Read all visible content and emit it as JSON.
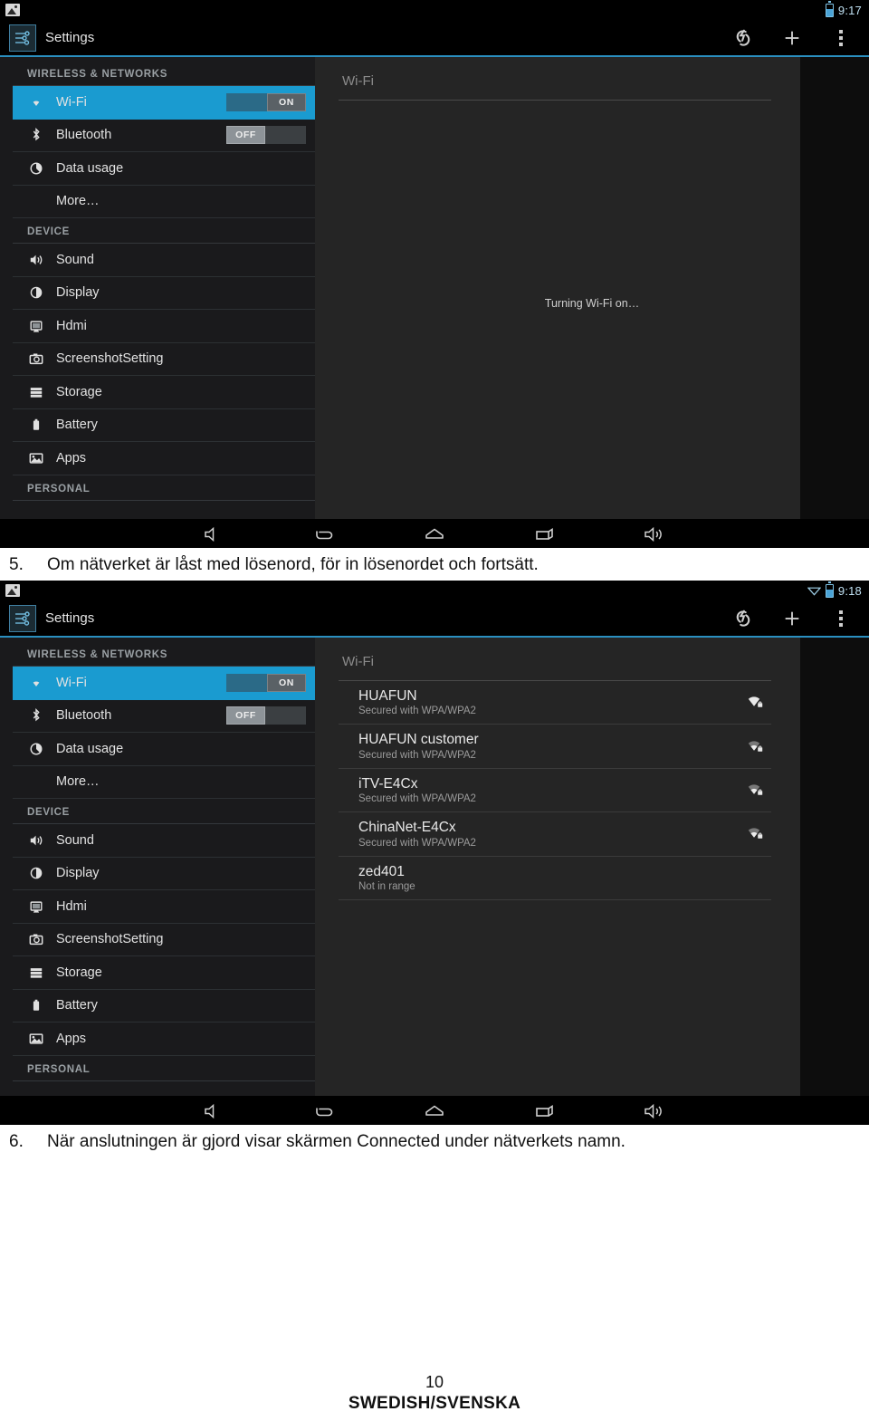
{
  "document": {
    "steps": [
      {
        "number": "5.",
        "text": "Om nätverket är låst med lösenord, för in lösenordet och fortsätt."
      },
      {
        "number": "6.",
        "text": "När anslutningen är gjord visar skärmen Connected under nätverkets namn."
      }
    ],
    "footer": {
      "page_number": "10",
      "language": "SWEDISH/SVENSKA"
    }
  },
  "colors": {
    "accent_blue": "#1a9bd0",
    "action_bar_underline": "#2a8fc0",
    "status_text": "#bfe0f2",
    "sidebar_bg": "#1a1a1c",
    "content_bg": "#252525"
  },
  "screenshot_1": {
    "status_bar": {
      "notification_icon": "photo-icon",
      "battery_icon": "battery-icon",
      "clock": "9:17"
    },
    "action_bar": {
      "app_icon": "settings-sliders-icon",
      "title": "Settings",
      "actions": [
        {
          "name": "scan-icon",
          "label": "Scan"
        },
        {
          "name": "add-network-icon",
          "label": "Add network"
        },
        {
          "name": "overflow-menu-icon",
          "label": "More options"
        }
      ]
    },
    "sidebar": {
      "sections": [
        {
          "header": "WIRELESS & NETWORKS",
          "items": [
            {
              "icon": "wifi-icon",
              "label": "Wi-Fi",
              "selected": true,
              "toggle": "ON"
            },
            {
              "icon": "bluetooth-icon",
              "label": "Bluetooth",
              "selected": false,
              "toggle": "OFF"
            },
            {
              "icon": "data-usage-icon",
              "label": "Data usage",
              "selected": false
            },
            {
              "icon": "",
              "label": "More…",
              "selected": false
            }
          ]
        },
        {
          "header": "DEVICE",
          "items": [
            {
              "icon": "sound-icon",
              "label": "Sound",
              "selected": false
            },
            {
              "icon": "display-icon",
              "label": "Display",
              "selected": false
            },
            {
              "icon": "hdmi-icon",
              "label": "Hdmi",
              "selected": false
            },
            {
              "icon": "screenshot-setting-icon",
              "label": "ScreenshotSetting",
              "selected": false
            },
            {
              "icon": "storage-icon",
              "label": "Storage",
              "selected": false
            },
            {
              "icon": "battery-icon",
              "label": "Battery",
              "selected": false
            },
            {
              "icon": "apps-icon",
              "label": "Apps",
              "selected": false
            }
          ]
        },
        {
          "header": "PERSONAL",
          "items": []
        }
      ]
    },
    "content": {
      "pane_title": "Wi-Fi",
      "status_message": "Turning Wi-Fi on…",
      "networks": []
    },
    "nav_bar": [
      {
        "name": "volume-down-icon"
      },
      {
        "name": "back-icon"
      },
      {
        "name": "home-icon"
      },
      {
        "name": "recents-icon"
      },
      {
        "name": "volume-up-icon"
      }
    ]
  },
  "screenshot_2": {
    "status_bar": {
      "notification_icon": "photo-icon",
      "wifi_icon": "wifi-signal-icon",
      "battery_icon": "battery-icon",
      "clock": "9:18"
    },
    "action_bar": {
      "app_icon": "settings-sliders-icon",
      "title": "Settings",
      "actions": [
        {
          "name": "scan-icon",
          "label": "Scan"
        },
        {
          "name": "add-network-icon",
          "label": "Add network"
        },
        {
          "name": "overflow-menu-icon",
          "label": "More options"
        }
      ]
    },
    "sidebar": {
      "sections": [
        {
          "header": "WIRELESS & NETWORKS",
          "items": [
            {
              "icon": "wifi-icon",
              "label": "Wi-Fi",
              "selected": true,
              "toggle": "ON"
            },
            {
              "icon": "bluetooth-icon",
              "label": "Bluetooth",
              "selected": false,
              "toggle": "OFF"
            },
            {
              "icon": "data-usage-icon",
              "label": "Data usage",
              "selected": false
            },
            {
              "icon": "",
              "label": "More…",
              "selected": false
            }
          ]
        },
        {
          "header": "DEVICE",
          "items": [
            {
              "icon": "sound-icon",
              "label": "Sound",
              "selected": false
            },
            {
              "icon": "display-icon",
              "label": "Display",
              "selected": false
            },
            {
              "icon": "hdmi-icon",
              "label": "Hdmi",
              "selected": false
            },
            {
              "icon": "screenshot-setting-icon",
              "label": "ScreenshotSetting",
              "selected": false
            },
            {
              "icon": "storage-icon",
              "label": "Storage",
              "selected": false
            },
            {
              "icon": "battery-icon",
              "label": "Battery",
              "selected": false
            },
            {
              "icon": "apps-icon",
              "label": "Apps",
              "selected": false
            }
          ]
        },
        {
          "header": "PERSONAL",
          "items": []
        }
      ]
    },
    "content": {
      "pane_title": "Wi-Fi",
      "networks": [
        {
          "ssid": "HUAFUN",
          "status": "Secured with WPA/WPA2",
          "secured": true,
          "signal": 4
        },
        {
          "ssid": "HUAFUN customer",
          "status": "Secured with WPA/WPA2",
          "secured": true,
          "signal": 3
        },
        {
          "ssid": "iTV-E4Cx",
          "status": "Secured with WPA/WPA2",
          "secured": true,
          "signal": 3
        },
        {
          "ssid": "ChinaNet-E4Cx",
          "status": "Secured with WPA/WPA2",
          "secured": true,
          "signal": 3
        },
        {
          "ssid": "zed401",
          "status": "Not in range",
          "secured": false,
          "signal": 0
        }
      ]
    },
    "nav_bar": [
      {
        "name": "volume-down-icon"
      },
      {
        "name": "back-icon"
      },
      {
        "name": "home-icon"
      },
      {
        "name": "recents-icon"
      },
      {
        "name": "volume-up-icon"
      }
    ]
  }
}
